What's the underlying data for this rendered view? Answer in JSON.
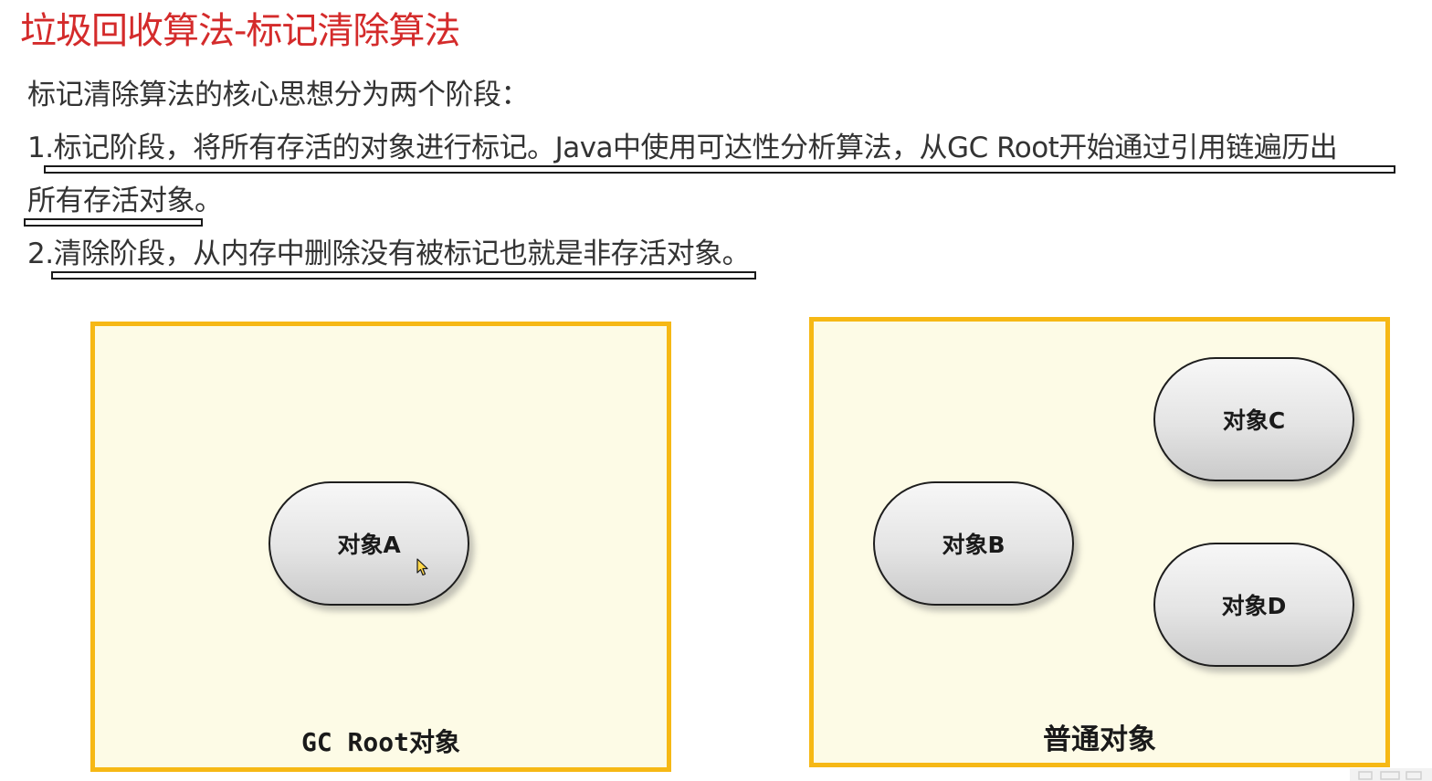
{
  "slide": {
    "title": "垃圾回收算法-标记清除算法",
    "intro": "标记清除算法的核心思想分为两个阶段：",
    "step1_line1": "1.标记阶段，将所有存活的对象进行标记。Java中使用可达性分析算法，从GC Root开始通过引用链遍历出",
    "step1_line2": "所有存活对象。",
    "step2": "2.清除阶段，从内存中删除没有被标记也就是非存活对象。"
  },
  "panels": {
    "left": {
      "caption": "GC Root对象",
      "objects": [
        "对象A"
      ]
    },
    "right": {
      "caption": "普通对象",
      "objects": [
        "对象B",
        "对象C",
        "对象D"
      ]
    }
  },
  "colors": {
    "title": "#d42b2b",
    "panel_border": "#f6b815",
    "panel_fill": "#fdfbe6",
    "object_outline": "#1e1e1e"
  },
  "icons": {
    "cursor": "mouse-pointer-icon"
  }
}
